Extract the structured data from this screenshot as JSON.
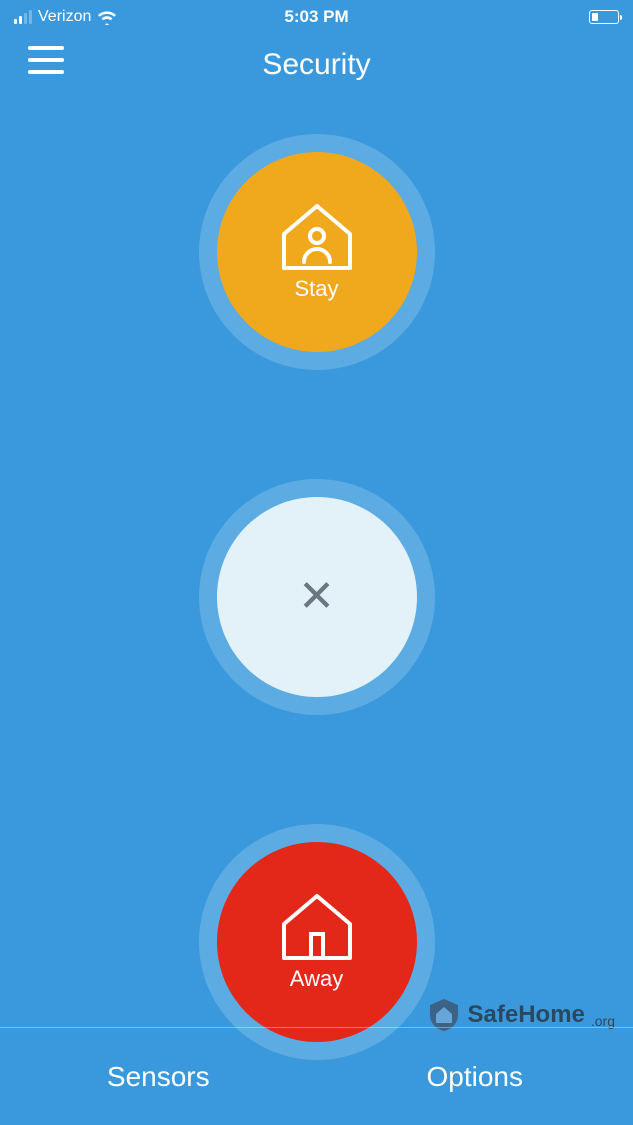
{
  "status_bar": {
    "carrier": "Verizon",
    "time": "5:03 PM"
  },
  "header": {
    "title": "Security"
  },
  "modes": {
    "stay": {
      "label": "Stay",
      "color": "#f0a81d"
    },
    "disarm": {
      "label": ""
    },
    "away": {
      "label": "Away",
      "color": "#e32719"
    }
  },
  "footer": {
    "sensors": "Sensors",
    "options": "Options"
  },
  "watermark": {
    "text": "SafeHome",
    "suffix": ".org"
  }
}
